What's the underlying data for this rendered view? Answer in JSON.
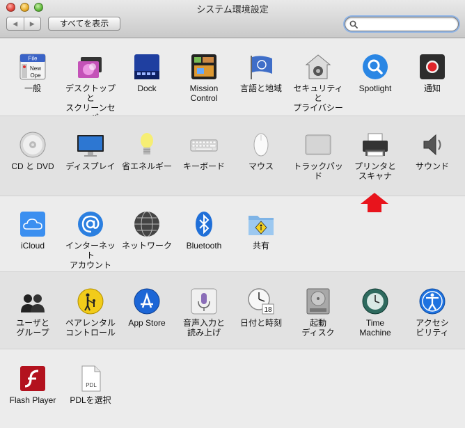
{
  "window": {
    "title": "システム環境設定",
    "show_all_label": "すべてを表示",
    "nav_back": "◀",
    "nav_forward": "▶",
    "search": {
      "value": "",
      "placeholder": ""
    }
  },
  "rows": {
    "personal": [
      {
        "id": "general",
        "label": "一般",
        "icon": "general-icon"
      },
      {
        "id": "desktop",
        "label": "デスクトップと\nスクリーンセーバ",
        "icon": "desktop-screensaver-icon"
      },
      {
        "id": "dock",
        "label": "Dock",
        "icon": "dock-icon"
      },
      {
        "id": "mission",
        "label": "Mission\nControl",
        "icon": "mission-control-icon"
      },
      {
        "id": "language",
        "label": "言語と地域",
        "icon": "language-region-icon"
      },
      {
        "id": "security",
        "label": "セキュリティと\nプライバシー",
        "icon": "security-privacy-icon"
      },
      {
        "id": "spotlight",
        "label": "Spotlight",
        "icon": "spotlight-icon"
      },
      {
        "id": "notifications",
        "label": "通知",
        "icon": "notifications-icon"
      }
    ],
    "hardware": [
      {
        "id": "cddvd",
        "label": "CD と DVD",
        "icon": "cd-dvd-icon"
      },
      {
        "id": "display",
        "label": "ディスプレイ",
        "icon": "display-icon"
      },
      {
        "id": "energy",
        "label": "省エネルギー",
        "icon": "energy-saver-icon"
      },
      {
        "id": "keyboard",
        "label": "キーボード",
        "icon": "keyboard-icon"
      },
      {
        "id": "mouse",
        "label": "マウス",
        "icon": "mouse-icon"
      },
      {
        "id": "trackpad",
        "label": "トラックパッド",
        "icon": "trackpad-icon"
      },
      {
        "id": "printers",
        "label": "プリンタと\nスキャナ",
        "icon": "printer-scanner-icon"
      },
      {
        "id": "sound",
        "label": "サウンド",
        "icon": "sound-icon"
      }
    ],
    "internet": [
      {
        "id": "icloud",
        "label": "iCloud",
        "icon": "icloud-icon"
      },
      {
        "id": "accounts",
        "label": "インターネット\nアカウント",
        "icon": "internet-accounts-icon"
      },
      {
        "id": "network",
        "label": "ネットワーク",
        "icon": "network-icon"
      },
      {
        "id": "bluetooth",
        "label": "Bluetooth",
        "icon": "bluetooth-icon"
      },
      {
        "id": "sharing",
        "label": "共有",
        "icon": "sharing-icon"
      }
    ],
    "system": [
      {
        "id": "users",
        "label": "ユーザと\nグループ",
        "icon": "users-groups-icon"
      },
      {
        "id": "parental",
        "label": "ペアレンタル\nコントロール",
        "icon": "parental-controls-icon"
      },
      {
        "id": "appstore",
        "label": "App Store",
        "icon": "app-store-icon"
      },
      {
        "id": "dictation",
        "label": "音声入力と\n読み上げ",
        "icon": "dictation-speech-icon"
      },
      {
        "id": "datetime",
        "label": "日付と時刻",
        "icon": "date-time-icon"
      },
      {
        "id": "startup",
        "label": "起動\nディスク",
        "icon": "startup-disk-icon"
      },
      {
        "id": "timemachine",
        "label": "Time\nMachine",
        "icon": "time-machine-icon"
      },
      {
        "id": "accessibility",
        "label": "アクセシ\nビリティ",
        "icon": "accessibility-icon"
      }
    ],
    "other": [
      {
        "id": "flash",
        "label": "Flash Player",
        "icon": "flash-player-icon"
      },
      {
        "id": "pdl",
        "label": "PDLを選択",
        "icon": "pdl-icon"
      }
    ]
  },
  "icon_text": {
    "general_file": "File",
    "general_new": "New",
    "general_open": "Ope",
    "calendar_day": "18",
    "pdl_badge": "PDL"
  },
  "colors": {
    "accent_arrow": "#e8141c",
    "search_focus": "#8fb4e6"
  }
}
